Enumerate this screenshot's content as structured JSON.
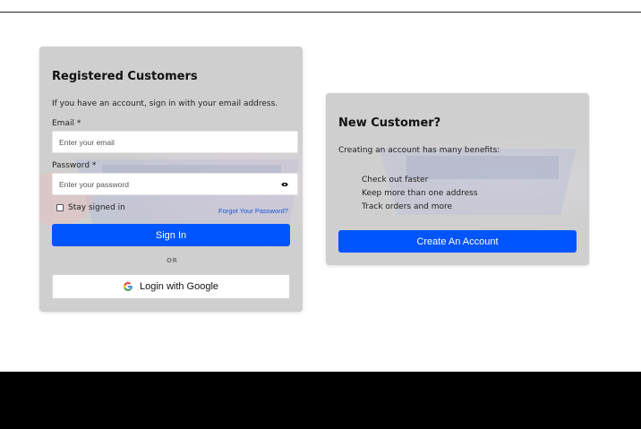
{
  "login": {
    "title": "Registered Customers",
    "description": "If you have an account, sign in with your email address.",
    "email_label": "Email *",
    "email_placeholder": "Enter your email",
    "password_label": "Password *",
    "password_placeholder": "Enter your password",
    "stay_signed_in": "Stay signed in",
    "forgot_password": "Forgot Your Password?",
    "sign_in_button": "Sign In",
    "or_divider": "OR",
    "google_button": "Login with Google"
  },
  "new_customer": {
    "title": "New Customer?",
    "description": "Creating an account has many benefits:",
    "benefits": [
      "Check out faster",
      "Keep more than one address",
      "Track orders and more"
    ],
    "create_button": "Create An Account"
  },
  "colors": {
    "primary_button": "#0055ff",
    "card_background": "#cfcfcf",
    "footer": "#000000",
    "link": "#1a56db"
  },
  "icons": {
    "password_toggle": "eye-icon",
    "google": "google-logo-icon"
  }
}
